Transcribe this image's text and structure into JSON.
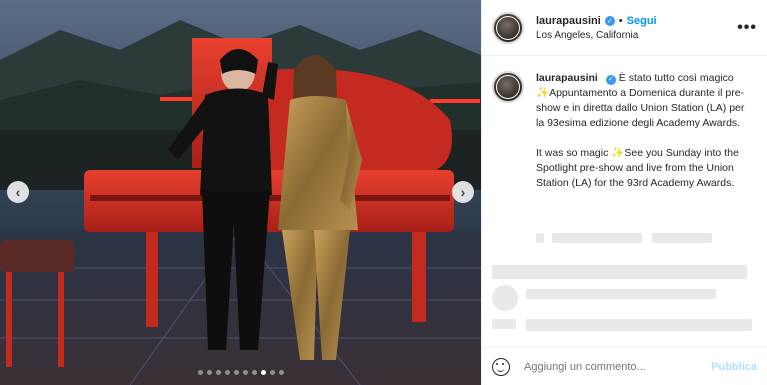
{
  "header": {
    "username": "laurapausini",
    "separator": "•",
    "follow_label": "Segui",
    "location": "Los Angeles, California",
    "more_label": "•••"
  },
  "caption": {
    "username": "laurapausini",
    "text_it_a": "È stato tutto così magico",
    "text_it_b": "Appuntamento a Domenica durante il pre-show e in diretta dallo Union Station (LA) per la 93esima edizione degli Academy Awards.",
    "text_en_a": "It was so magic",
    "text_en_b": "See you Sunday into the Spotlight pre-show and live from the Union Station (LA) for the 93rd Academy Awards.",
    "sparkle": "✨"
  },
  "carousel": {
    "prev_label": "‹",
    "next_label": "›",
    "dot_count": 10,
    "active_dot": 7
  },
  "composer": {
    "placeholder": "Aggiungi un commento...",
    "publish_label": "Pubblica"
  },
  "colors": {
    "link_blue": "#0095f6",
    "publish_disabled": "#b2dffc",
    "verified": "#3897f0"
  }
}
